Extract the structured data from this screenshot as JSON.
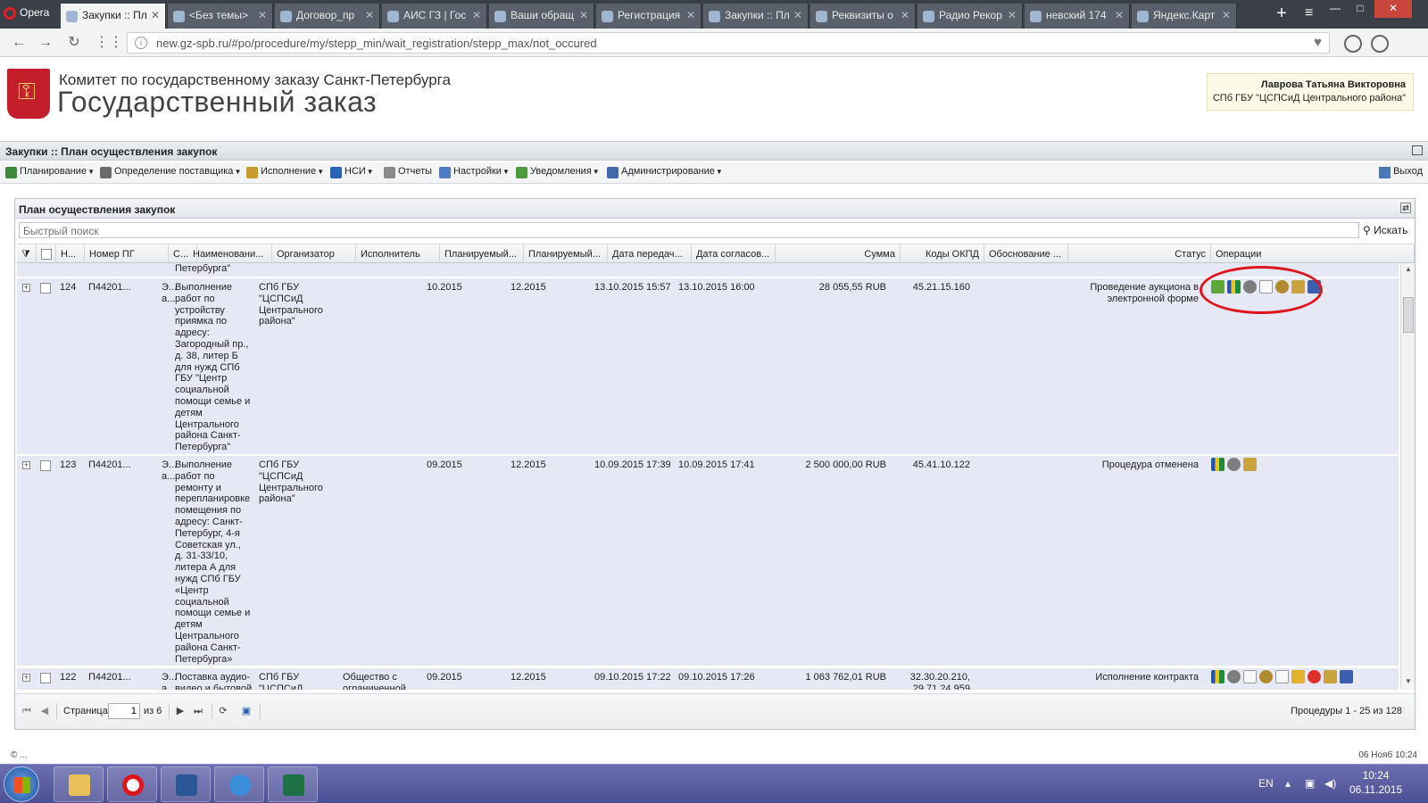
{
  "browser": {
    "opera_label": "Opera",
    "tabs": [
      {
        "label": "Закупки :: Пл",
        "active": true
      },
      {
        "label": "<Без темы>"
      },
      {
        "label": "Договор_пр"
      },
      {
        "label": "АИС ГЗ | Гос"
      },
      {
        "label": "Ваши обращ"
      },
      {
        "label": "Регистрация"
      },
      {
        "label": "Закупки :: Пл"
      },
      {
        "label": "Реквизиты о"
      },
      {
        "label": "Радио Рекор"
      },
      {
        "label": "невский 174"
      },
      {
        "label": "Яндекс.Карт"
      }
    ],
    "url": "new.gz-spb.ru/#po/procedure/my/stepp_min/wait_registration/stepp_max/not_occured"
  },
  "site": {
    "subtitle": "Комитет по государственному заказу Санкт-Петербурга",
    "title": "Государственный заказ",
    "user_name": "Лаврова Татьяна Викторовна",
    "user_org": "СПб ГБУ \"ЦСПСиД Центрального района\""
  },
  "module": {
    "title": "Закупки :: План осуществления закупок"
  },
  "menu": {
    "items": [
      {
        "label": "Планирование",
        "color": "#3f8a3a"
      },
      {
        "label": "Определение поставщика",
        "color": "#6b6b6b"
      },
      {
        "label": "Исполнение",
        "color": "#c79a2c"
      },
      {
        "label": "НСИ",
        "color": "#2a63b5"
      },
      {
        "label": "Отчеты",
        "color": "#8a8a8a"
      },
      {
        "label": "Настройки",
        "color": "#4d7cc2"
      },
      {
        "label": "Уведомления",
        "color": "#4e9b3f"
      },
      {
        "label": "Администрирование",
        "color": "#4466aa"
      }
    ],
    "exit_label": "Выход"
  },
  "panel": {
    "title": "План осуществления закупок",
    "search_placeholder": "Быстрый поиск",
    "search_button": "Искать"
  },
  "grid": {
    "columns": [
      "Н...",
      "Номер ПГ",
      "С...",
      "Наименовани...",
      "Организатор",
      "Исполнитель",
      "Планируемый...",
      "Планируемый...",
      "Дата передач...",
      "Дата согласов...",
      "Сумма",
      "Коды ОКПД",
      "Обоснование ...",
      "Статус",
      "Операции"
    ],
    "partial_top_text": "Петербурга\"",
    "rows": [
      {
        "num": "124",
        "pg": "П44201...",
        "s": "Э...\nа...",
        "name": "Выполнение\nработ по\nустройству\nприямка по\nадресу:\nЗагородный пр.,\nд. 38, литер Б\nдля нужд СПб\nГБУ \"Центр\nсоциальной\nпомощи семье и\nдетям\nЦентрального\nрайона Санкт-\nПетербурга\"",
        "organizer": "СПб ГБУ\n\"ЦСПСиД\nЦентрального\nрайона\"",
        "executor": "",
        "plan1": "10.2015",
        "plan2": "12.2015",
        "date_transfer": "13.10.2015 15:57",
        "date_approve": "13.10.2015 16:00",
        "sum": "28 055,55 RUB",
        "okpd": "45.21.15.160",
        "basis": "",
        "status": "Проведение аукциона в\nэлектронной форме",
        "ops": [
          "green",
          "chart",
          "gear",
          "doc",
          "eagle",
          "scroll",
          "blue"
        ]
      },
      {
        "num": "123",
        "pg": "П44201...",
        "s": "Э...\nа...",
        "name": "Выполнение\nработ по\nремонту и\nперепланировке\nпомещения по\nадресу: Санкт-\nПетербург, 4-я\nСоветская ул.,\nд. 31-33/10,\nлитера А для\nнужд СПб ГБУ\n«Центр\nсоциальной\nпомощи семье и\nдетям\nЦентрального\nрайона Санкт-\nПетербурга»",
        "organizer": "СПб ГБУ\n\"ЦСПСиД\nЦентрального\nрайона\"",
        "executor": "",
        "plan1": "09.2015",
        "plan2": "12.2015",
        "date_transfer": "10.09.2015 17:39",
        "date_approve": "10.09.2015 17:41",
        "sum": "2 500 000,00 RUB",
        "okpd": "45.41.10.122",
        "basis": "",
        "status": "Процедура отменена",
        "ops": [
          "chart",
          "gear",
          "scroll"
        ]
      },
      {
        "num": "122",
        "pg": "П44201...",
        "s": "Э...\nа...",
        "name": "Поставка аудио-\nвидео и бытовой",
        "organizer": "СПб ГБУ\n\"ЦСПСиД",
        "executor": "Общество с\nограниченной",
        "plan1": "09.2015",
        "plan2": "12.2015",
        "date_transfer": "09.10.2015 17:22",
        "date_approve": "09.10.2015 17:26",
        "sum": "1 063 762,01 RUB",
        "okpd": "32.30.20.210,\n29.71.24.959",
        "basis": "",
        "status": "Исполнение контракта",
        "ops": [
          "chart",
          "gear",
          "doc",
          "eagle",
          "doc",
          "yellow",
          "red",
          "scroll",
          "blue"
        ]
      }
    ]
  },
  "pager": {
    "page_label": "Страница",
    "page_value": "1",
    "of_label": "из 6",
    "summary": "Процедуры 1 - 25 из 128"
  },
  "footer": {
    "copyright": "© ...",
    "datetime": "06 Нояб 10:24"
  },
  "taskbar": {
    "lang": "EN",
    "time": "10:24",
    "date": "06.11.2015"
  }
}
